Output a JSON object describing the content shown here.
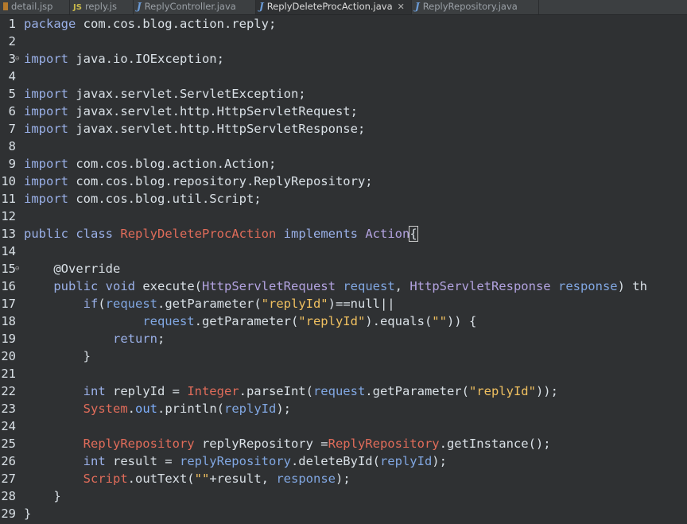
{
  "tabs": [
    {
      "label": "detail.jsp",
      "icon": "jsp-file-icon",
      "active": false
    },
    {
      "label": "reply.js",
      "icon": "js-file-icon",
      "active": false
    },
    {
      "label": "ReplyController.java",
      "icon": "java-file-icon",
      "active": false
    },
    {
      "label": "ReplyDeleteProcAction.java",
      "icon": "java-file-icon",
      "active": true,
      "close": "✕"
    },
    {
      "label": "ReplyRepository.java",
      "icon": "java-file-icon",
      "active": false
    }
  ],
  "editor": {
    "line_numbers": [
      "1",
      "2",
      "3",
      "4",
      "5",
      "6",
      "7",
      "8",
      "9",
      "10",
      "11",
      "12",
      "13",
      "14",
      "15",
      "16",
      "17",
      "18",
      "19",
      "20",
      "21",
      "22",
      "23",
      "24",
      "25",
      "26",
      "27",
      "28",
      "29"
    ],
    "lines": [
      [
        {
          "t": "package",
          "c": "kw"
        },
        {
          "t": " com.cos.blog.action.reply;",
          "c": "pkg"
        }
      ],
      [],
      [
        {
          "t": "import",
          "c": "kw"
        },
        {
          "t": " java.io.IOException;",
          "c": "pkg"
        }
      ],
      [],
      [
        {
          "t": "import",
          "c": "kw"
        },
        {
          "t": " javax.servlet.ServletException;",
          "c": "pkg"
        }
      ],
      [
        {
          "t": "import",
          "c": "kw"
        },
        {
          "t": " javax.servlet.http.HttpServletRequest;",
          "c": "pkg"
        }
      ],
      [
        {
          "t": "import",
          "c": "kw"
        },
        {
          "t": " javax.servlet.http.HttpServletResponse;",
          "c": "pkg"
        }
      ],
      [],
      [
        {
          "t": "import",
          "c": "kw"
        },
        {
          "t": " com.cos.blog.action.Action;",
          "c": "pkg"
        }
      ],
      [
        {
          "t": "import",
          "c": "kw"
        },
        {
          "t": " com.cos.blog.repository.ReplyRepository;",
          "c": "pkg"
        }
      ],
      [
        {
          "t": "import",
          "c": "kw"
        },
        {
          "t": " com.cos.blog.util.Script;",
          "c": "pkg"
        }
      ],
      [],
      [
        {
          "t": "public",
          "c": "kw"
        },
        {
          "t": " "
        },
        {
          "t": "class",
          "c": "kw"
        },
        {
          "t": " "
        },
        {
          "t": "ReplyDeleteProcAction",
          "c": "cls"
        },
        {
          "t": " "
        },
        {
          "t": "implements",
          "c": "kw"
        },
        {
          "t": " "
        },
        {
          "t": "Action",
          "c": "itf"
        },
        {
          "t": "{",
          "c": "caret"
        }
      ],
      [],
      [
        {
          "t": "    @Override",
          "c": "ann"
        }
      ],
      [
        {
          "t": "    "
        },
        {
          "t": "public",
          "c": "kw"
        },
        {
          "t": " "
        },
        {
          "t": "void",
          "c": "kw"
        },
        {
          "t": " execute("
        },
        {
          "t": "HttpServletRequest",
          "c": "itf"
        },
        {
          "t": " "
        },
        {
          "t": "request",
          "c": "var"
        },
        {
          "t": ", "
        },
        {
          "t": "HttpServletResponse",
          "c": "itf"
        },
        {
          "t": " "
        },
        {
          "t": "response",
          "c": "var"
        },
        {
          "t": ") th"
        }
      ],
      [
        {
          "t": "        "
        },
        {
          "t": "if",
          "c": "kw"
        },
        {
          "t": "("
        },
        {
          "t": "request",
          "c": "var"
        },
        {
          "t": ".getParameter("
        },
        {
          "t": "\"replyId\"",
          "c": "str"
        },
        {
          "t": ")==null||"
        }
      ],
      [
        {
          "t": "                "
        },
        {
          "t": "request",
          "c": "var"
        },
        {
          "t": ".getParameter("
        },
        {
          "t": "\"replyId\"",
          "c": "str"
        },
        {
          "t": ").equals("
        },
        {
          "t": "\"\"",
          "c": "str"
        },
        {
          "t": ")) {"
        }
      ],
      [
        {
          "t": "            "
        },
        {
          "t": "return",
          "c": "kw"
        },
        {
          "t": ";"
        }
      ],
      [
        {
          "t": "        }"
        }
      ],
      [],
      [
        {
          "t": "        "
        },
        {
          "t": "int",
          "c": "kw"
        },
        {
          "t": " replyId = "
        },
        {
          "t": "Integer",
          "c": "cls"
        },
        {
          "t": ".parseInt("
        },
        {
          "t": "request",
          "c": "var"
        },
        {
          "t": ".getParameter("
        },
        {
          "t": "\"replyId\"",
          "c": "str"
        },
        {
          "t": "));"
        }
      ],
      [
        {
          "t": "        "
        },
        {
          "t": "System",
          "c": "cls"
        },
        {
          "t": "."
        },
        {
          "t": "out",
          "c": "fld"
        },
        {
          "t": ".println("
        },
        {
          "t": "replyId",
          "c": "var"
        },
        {
          "t": ");"
        }
      ],
      [],
      [
        {
          "t": "        "
        },
        {
          "t": "ReplyRepository",
          "c": "cls"
        },
        {
          "t": " replyRepository ="
        },
        {
          "t": "ReplyRepository",
          "c": "cls"
        },
        {
          "t": ".getInstance();"
        }
      ],
      [
        {
          "t": "        "
        },
        {
          "t": "int",
          "c": "kw"
        },
        {
          "t": " result = "
        },
        {
          "t": "replyRepository",
          "c": "var"
        },
        {
          "t": ".deleteById("
        },
        {
          "t": "replyId",
          "c": "var"
        },
        {
          "t": ");"
        }
      ],
      [
        {
          "t": "        "
        },
        {
          "t": "Script",
          "c": "cls"
        },
        {
          "t": ".outText("
        },
        {
          "t": "\"\"",
          "c": "str"
        },
        {
          "t": "+result, "
        },
        {
          "t": "response",
          "c": "var"
        },
        {
          "t": ");"
        }
      ],
      [
        {
          "t": "    }"
        }
      ],
      [
        {
          "t": "}"
        }
      ]
    ],
    "fold_markers_on_lines": [
      "3",
      "15"
    ],
    "fold_glyph": "⊖"
  }
}
